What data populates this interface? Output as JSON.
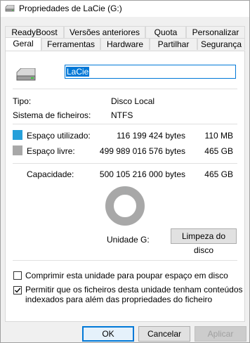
{
  "window": {
    "title": "Propriedades de LaCie (G:)"
  },
  "tabs": {
    "row_back": [
      "ReadyBoost",
      "Versões anteriores",
      "Quota",
      "Personalizar"
    ],
    "row_front": [
      "Geral",
      "Ferramentas",
      "Hardware",
      "Partilhar",
      "Segurança"
    ],
    "active": "Geral"
  },
  "general": {
    "name_value": "LaCie",
    "type_label": "Tipo:",
    "type_value": "Disco Local",
    "fs_label": "Sistema de ficheiros:",
    "fs_value": "NTFS",
    "used_label": "Espaço utilizado:",
    "used_bytes": "116 199 424 bytes",
    "used_size": "110 MB",
    "free_label": "Espaço livre:",
    "free_bytes": "499 989 016 576 bytes",
    "free_size": "465 GB",
    "capacity_label": "Capacidade:",
    "capacity_bytes": "500 105 216 000 bytes",
    "capacity_size": "465 GB",
    "drive_label": "Unidade G:",
    "cleanup_button": "Limpeza do disco",
    "compress_label": "Comprimir esta unidade para poupar espaço em disco",
    "compress_checked": false,
    "index_label_line1": "Permitir que os ficheiros desta unidade tenham conteúdos",
    "index_label_line2": "indexados para além das propriedades do ficheiro",
    "index_checked": true,
    "used_fraction": 0.0002,
    "colors": {
      "used": "#26a0da",
      "free": "#a8a8a8"
    }
  },
  "footer": {
    "ok": "OK",
    "cancel": "Cancelar",
    "apply": "Aplicar"
  }
}
